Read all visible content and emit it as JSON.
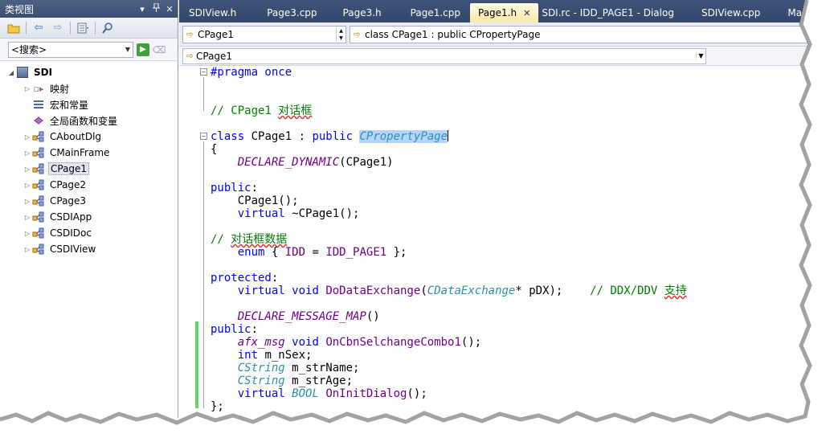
{
  "class_view": {
    "title": "类视图",
    "title_buttons": [
      "▾",
      "ᵒ",
      "✕"
    ],
    "search_placeholder": "<搜索>",
    "tree": [
      {
        "label": "SDI",
        "expander": "◢",
        "icon": "solution-icon"
      },
      {
        "label": "映射",
        "expander": "▷",
        "icon": "map-icon"
      },
      {
        "label": "宏和常量",
        "expander": "",
        "icon": "macro-icon"
      },
      {
        "label": "全局函数和变量",
        "expander": "",
        "icon": "global-icon"
      },
      {
        "label": "CAboutDlg",
        "expander": "▷",
        "icon": "class-icon"
      },
      {
        "label": "CMainFrame",
        "expander": "▷",
        "icon": "class-icon"
      },
      {
        "label": "CPage1",
        "expander": "▷",
        "icon": "class-icon",
        "selected": true
      },
      {
        "label": "CPage2",
        "expander": "▷",
        "icon": "class-icon"
      },
      {
        "label": "CPage3",
        "expander": "▷",
        "icon": "class-icon"
      },
      {
        "label": "CSDIApp",
        "expander": "▷",
        "icon": "class-icon"
      },
      {
        "label": "CSDIDoc",
        "expander": "▷",
        "icon": "class-icon"
      },
      {
        "label": "CSDIView",
        "expander": "▷",
        "icon": "class-icon"
      }
    ]
  },
  "editor": {
    "tabs": [
      {
        "label": "SDIView.h"
      },
      {
        "label": "Page3.cpp"
      },
      {
        "label": "Page3.h"
      },
      {
        "label": "Page1.cpp"
      },
      {
        "label": "Page1.h",
        "active": true
      },
      {
        "label": "SDI.rc - IDD_PAGE1 - Dialog"
      },
      {
        "label": "SDIView.cpp"
      },
      {
        "label": "MainF"
      }
    ],
    "class_dropdown": "CPage1",
    "member_dropdown": "class CPage1 : public CPropertyPage",
    "scope_dropdown": "CPage1"
  },
  "colors": {
    "keyword": "#0000ff",
    "comment": "#008000",
    "macro": "#6f008a",
    "type": "#2b91af",
    "tab_bar": "#3f5478",
    "changed_margin": "#6bd36b"
  }
}
